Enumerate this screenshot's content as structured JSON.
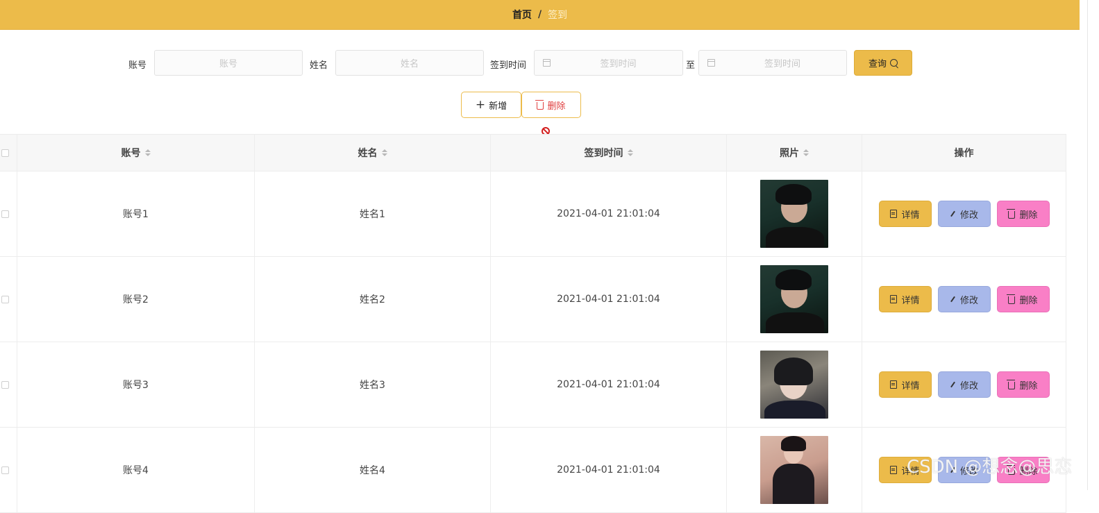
{
  "breadcrumb": {
    "home": "首页",
    "separator": "/",
    "current": "签到"
  },
  "search": {
    "account_label": "账号",
    "account_placeholder": "账号",
    "name_label": "姓名",
    "name_placeholder": "姓名",
    "time_label": "签到时间",
    "time_start_placeholder": "签到时间",
    "to_label": "至",
    "time_end_placeholder": "签到时间",
    "query_label": "查询"
  },
  "actions": {
    "add_label": "新增",
    "delete_label": "删除"
  },
  "table": {
    "headers": {
      "account": "账号",
      "name": "姓名",
      "time": "签到时间",
      "photo": "照片",
      "ops": "操作"
    },
    "op_labels": {
      "detail": "详情",
      "edit": "修改",
      "delete": "删除"
    },
    "rows": [
      {
        "account": "账号1",
        "name": "姓名1",
        "time": "2021-04-01 21:01:04",
        "photo": "portrait-male-dark"
      },
      {
        "account": "账号2",
        "name": "姓名2",
        "time": "2021-04-01 21:01:04",
        "photo": "portrait-male-dark"
      },
      {
        "account": "账号3",
        "name": "姓名3",
        "time": "2021-04-01 21:01:04",
        "photo": "portrait-female"
      },
      {
        "account": "账号4",
        "name": "姓名4",
        "time": "2021-04-01 21:01:04",
        "photo": "portrait-female-pink"
      }
    ]
  },
  "watermark": "CSDN @想念@思恋",
  "colors": {
    "accent": "#ecbb4a",
    "edit": "#a8b8ea",
    "delete": "#f97fc6",
    "danger": "#e04040"
  }
}
